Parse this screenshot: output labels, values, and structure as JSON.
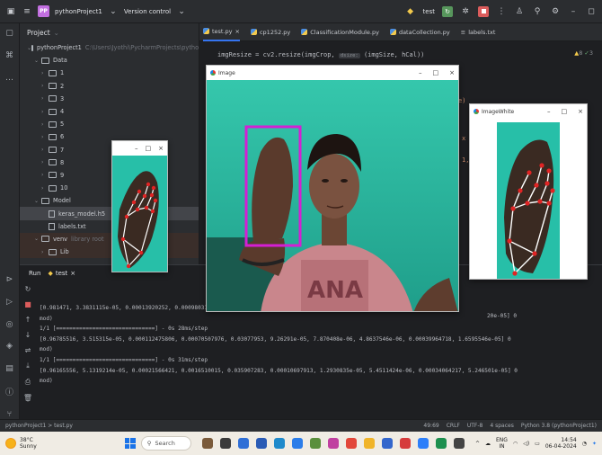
{
  "titlebar": {
    "project_badge": "PP",
    "project_name": "pythonProject1",
    "vcs_label": "Version control",
    "run_config": "test"
  },
  "project_panel": {
    "header": "Project",
    "root_label": "pythonProject1",
    "root_path": "C:\\Users\\Jyothi\\PycharmProjects\\pythonProje",
    "data_folder": "Data",
    "subfolders": [
      "1",
      "2",
      "3",
      "4",
      "5",
      "6",
      "7",
      "8",
      "9",
      "10"
    ],
    "model_folder": "Model",
    "model_files": [
      "keras_model.h5",
      "labels.txt"
    ],
    "venv_label": "venv",
    "venv_note": "library root",
    "lib_label": "Lib"
  },
  "editor": {
    "tabs": [
      "test.py",
      "cp1252.py",
      "ClassificationModule.py",
      "dataCollection.py",
      "labels.txt"
    ],
    "code_prefix": "imgResize = cv2.resize(imgCrop, ",
    "code_hint": "dsize:",
    "code_suffix": " (imgSize, hCal))",
    "warn_count": "8",
    "ok_count": "3",
    "frag_1": "e)",
    "frag_2": "x",
    "frag_3": "1,"
  },
  "run_panel": {
    "label": "Run",
    "tab": "test",
    "console_lines": [
      "[0.981471, 3.3831115e-05, 0.00013920252, 0.0009803193, ",
      "mod)",
      "1/1 [==============================] - 0s 28ms/step",
      "[0.96785516, 3.515315e-05, 0.000112475806, 0.00070507976, 0.03077953, 9.26291e-05, 7.870408e-06, 4.8637546e-06, 0.00039964718, 1.6595546e-05] 0",
      "mod)",
      "1/1 [==============================] - 0s 31ms/step",
      "[0.96165556, 5.1319214e-05, 0.00021566421, 0.0016510015, 0.035907283, 0.00010697913, 1.2930835e-05, 5.4511424e-06, 0.00034064217, 5.246501e-05] 0",
      "mod)"
    ],
    "behind_fragment": "20e-05] 0"
  },
  "statusbar": {
    "breadcrumb": "pythonProject1 > test.py",
    "position": "49:69",
    "line_sep": "CRLF",
    "encoding": "UTF-8",
    "indent": "4 spaces",
    "interpreter": "Python 3.8 (pythonProject1)"
  },
  "taskbar": {
    "temp": "38°C",
    "condition": "Sunny",
    "search_placeholder": "Search",
    "lang_top": "ENG",
    "lang_bottom": "IN",
    "time": "14:54",
    "date": "06-04-2024"
  },
  "windows": {
    "image": {
      "title": "Image"
    },
    "image_white": {
      "title": "ImageWhite"
    }
  },
  "colors": {
    "ide_bg": "#1e1f22",
    "panel_bg": "#2b2d30",
    "teal": "#27bfa8",
    "bbox_magenta": "#d41fd4",
    "landmark_red": "#e02424"
  }
}
